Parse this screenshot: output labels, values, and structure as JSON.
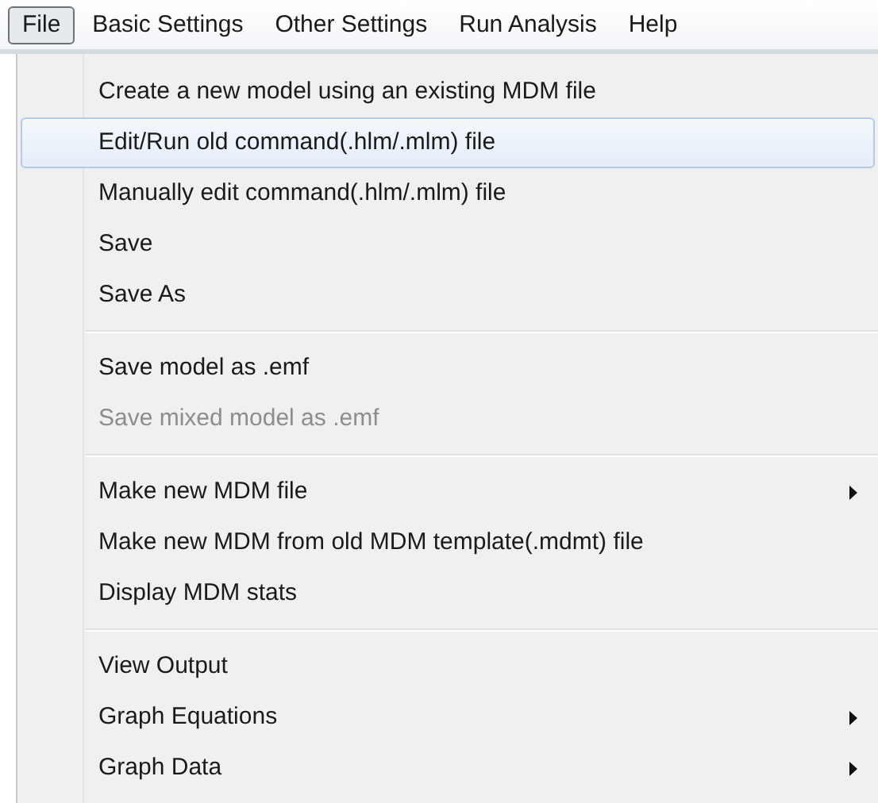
{
  "menu_bar": [
    {
      "label": "File",
      "selected": true
    },
    {
      "label": "Basic Settings",
      "selected": false
    },
    {
      "label": "Other Settings",
      "selected": false
    },
    {
      "label": "Run Analysis",
      "selected": false
    },
    {
      "label": "Help",
      "selected": false
    }
  ],
  "menu": [
    {
      "kind": "item",
      "label": "Create a new model using an existing MDM file",
      "selected": false,
      "disabled": false,
      "submenu": false
    },
    {
      "kind": "item",
      "label": "Edit/Run old command(.hlm/.mlm) file",
      "selected": true,
      "disabled": false,
      "submenu": false
    },
    {
      "kind": "item",
      "label": "Manually edit command(.hlm/.mlm) file",
      "selected": false,
      "disabled": false,
      "submenu": false
    },
    {
      "kind": "item",
      "label": "Save",
      "selected": false,
      "disabled": false,
      "submenu": false
    },
    {
      "kind": "item",
      "label": "Save As",
      "selected": false,
      "disabled": false,
      "submenu": false
    },
    {
      "kind": "separator"
    },
    {
      "kind": "item",
      "label": "Save model as .emf",
      "selected": false,
      "disabled": false,
      "submenu": false
    },
    {
      "kind": "item",
      "label": "Save mixed model as .emf",
      "selected": false,
      "disabled": true,
      "submenu": false
    },
    {
      "kind": "separator"
    },
    {
      "kind": "item",
      "label": "Make new MDM file",
      "selected": false,
      "disabled": false,
      "submenu": true
    },
    {
      "kind": "item",
      "label": "Make new MDM from old MDM template(.mdmt) file",
      "selected": false,
      "disabled": false,
      "submenu": false
    },
    {
      "kind": "item",
      "label": "Display MDM stats",
      "selected": false,
      "disabled": false,
      "submenu": false
    },
    {
      "kind": "separator"
    },
    {
      "kind": "item",
      "label": "View Output",
      "selected": false,
      "disabled": false,
      "submenu": false
    },
    {
      "kind": "item",
      "label": "Graph Equations",
      "selected": false,
      "disabled": false,
      "submenu": true
    },
    {
      "kind": "item",
      "label": "Graph Data",
      "selected": false,
      "disabled": false,
      "submenu": true
    }
  ]
}
